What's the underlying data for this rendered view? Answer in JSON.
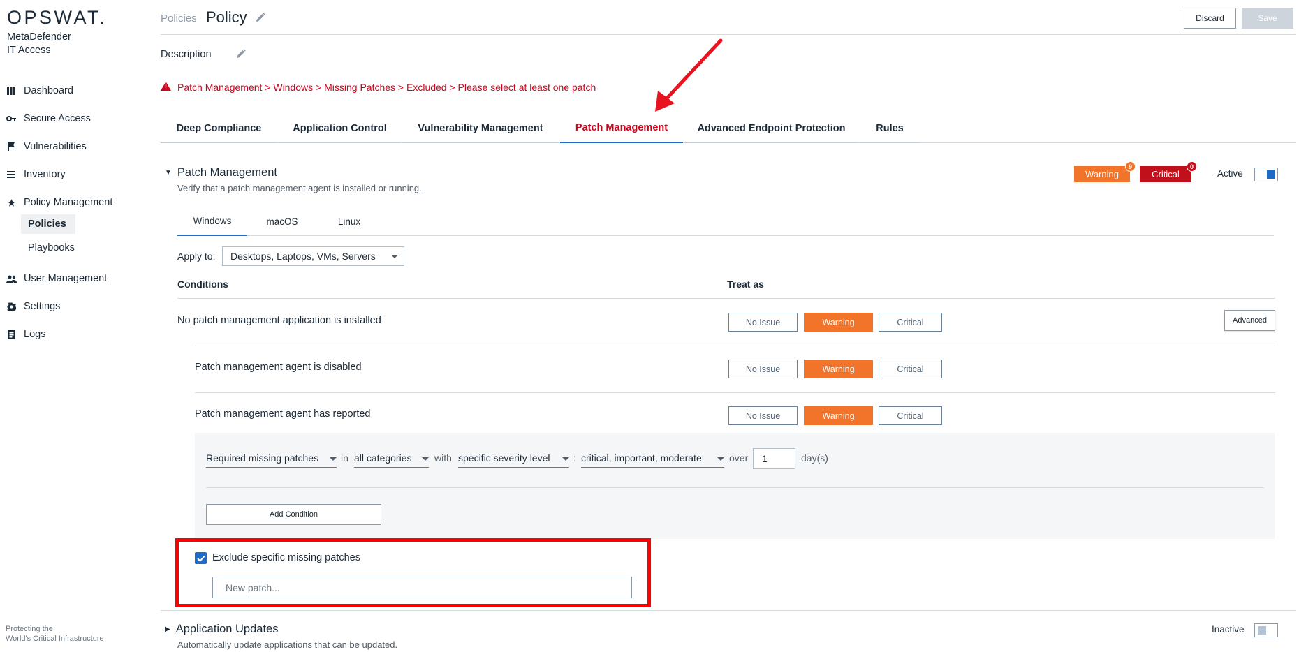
{
  "sidebar": {
    "logo": "OPSWAT.",
    "product_line1": "MetaDefender",
    "product_line2": "IT Access",
    "items": [
      {
        "label": "Dashboard",
        "icon": "dashboard-icon"
      },
      {
        "label": "Secure Access",
        "icon": "key-icon"
      },
      {
        "label": "Vulnerabilities",
        "icon": "flag-icon"
      },
      {
        "label": "Inventory",
        "icon": "list-icon"
      },
      {
        "label": "Policy Management",
        "icon": "star-icon"
      },
      {
        "label": "User Management",
        "icon": "users-icon"
      },
      {
        "label": "Settings",
        "icon": "gear-icon"
      },
      {
        "label": "Logs",
        "icon": "log-icon"
      }
    ],
    "sub_items": [
      {
        "label": "Policies",
        "active": true
      },
      {
        "label": "Playbooks",
        "active": false
      }
    ],
    "footer_line1": "Protecting the",
    "footer_line2": "World's Critical Infrastructure"
  },
  "header": {
    "breadcrumb": "Policies",
    "title": "Policy",
    "discard_label": "Discard",
    "save_label": "Save"
  },
  "description_label": "Description",
  "error_message": "Patch Management > Windows > Missing Patches > Excluded > Please select at least one patch",
  "tabs": [
    {
      "label": "Deep Compliance",
      "active": false
    },
    {
      "label": "Application Control",
      "active": false
    },
    {
      "label": "Vulnerability Management",
      "active": false
    },
    {
      "label": "Patch Management",
      "active": true
    },
    {
      "label": "Advanced Endpoint Protection",
      "active": false
    },
    {
      "label": "Rules",
      "active": false
    }
  ],
  "section": {
    "title": "Patch Management",
    "subtitle": "Verify that a patch management agent is installed or running.",
    "warning_badge": {
      "label": "Warning",
      "count": "9",
      "color": "#f1742a"
    },
    "critical_badge": {
      "label": "Critical",
      "count": "0",
      "color": "#c0101c"
    },
    "active_label": "Active",
    "active": true
  },
  "os_tabs": [
    {
      "label": "Windows",
      "active": true
    },
    {
      "label": "macOS",
      "active": false
    },
    {
      "label": "Linux",
      "active": false
    }
  ],
  "apply_to": {
    "label": "Apply to:",
    "value": "Desktops, Laptops, VMs, Servers"
  },
  "conditions_header": "Conditions",
  "treat_as_header": "Treat as",
  "treat_options": [
    "No Issue",
    "Warning",
    "Critical"
  ],
  "conditions": [
    {
      "text": "No patch management application is installed",
      "selected": "Warning"
    },
    {
      "text": "Patch management agent is disabled",
      "selected": "Warning"
    },
    {
      "text": "Patch management agent has reported",
      "selected": "Warning"
    }
  ],
  "advanced_label": "Advanced",
  "condition_builder": {
    "type": "Required missing patches",
    "in_word": "in",
    "category": "all categories",
    "with_word": "with",
    "severity_mode": "specific severity level",
    "colon": ":",
    "severities": "critical, important, moderate",
    "over_word": "over",
    "days_value": "1",
    "days_unit": "day(s)",
    "add_condition_label": "Add Condition"
  },
  "exclude": {
    "checked": true,
    "label": "Exclude specific missing patches",
    "placeholder": "New patch..."
  },
  "section2": {
    "title": "Application Updates",
    "subtitle": "Automatically update applications that can be updated.",
    "inactive_label": "Inactive",
    "active": false
  }
}
